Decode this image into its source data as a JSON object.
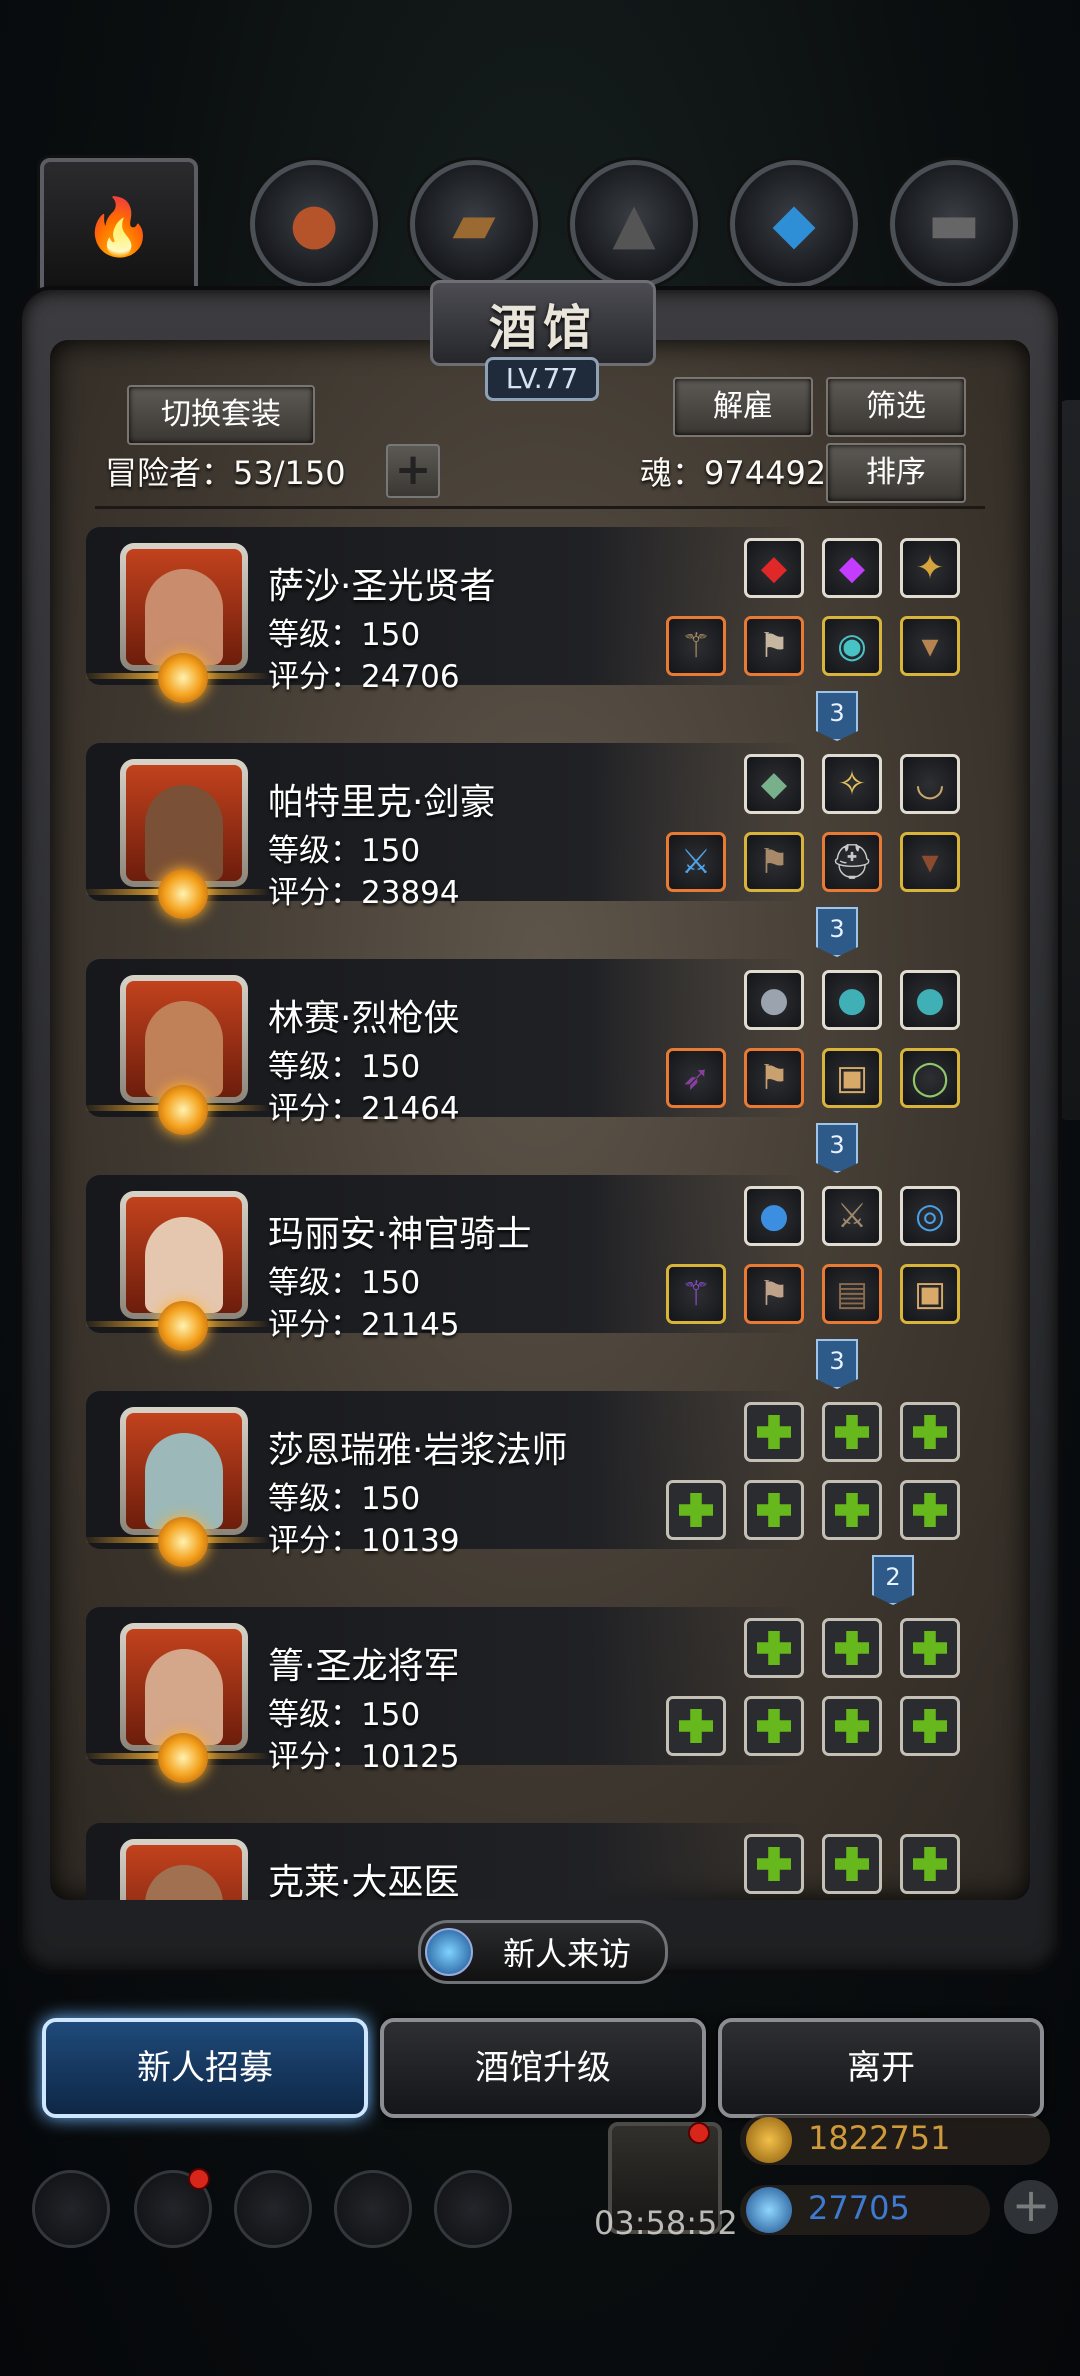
{
  "tabs": [
    {
      "icon": "flame-icon"
    },
    {
      "icon": "meat-icon"
    },
    {
      "icon": "wood-icon"
    },
    {
      "icon": "ore-icon"
    },
    {
      "icon": "crystal-icon"
    },
    {
      "icon": "metal-icon"
    }
  ],
  "header": {
    "title": "酒馆",
    "level": "LV.77",
    "switch_outfit": "切换套装",
    "dismiss": "解雇",
    "filter": "筛选",
    "sort": "排序",
    "adventurers": "冒险者：53/150",
    "soul": "魂：974492"
  },
  "heroes": [
    {
      "name": "萨沙·圣光贤者",
      "level": "等级：150",
      "score": "评分：24706",
      "face": "#c98c6c",
      "top": [
        {
          "icon": "red-gem-icon",
          "glyph": "◆",
          "color": "#e02828",
          "frame": "white"
        },
        {
          "icon": "purple-crystal-icon",
          "glyph": "◆",
          "color": "#c33cff",
          "frame": "white"
        },
        {
          "icon": "gold-ornament-icon",
          "glyph": "✦",
          "color": "#d6a43c",
          "frame": "white"
        }
      ],
      "bottom": [
        {
          "icon": "staff-icon",
          "glyph": "⚚",
          "color": "#b2926a",
          "frame": "orange"
        },
        {
          "icon": "armor-icon",
          "glyph": "⚑",
          "color": "#c8b7a0",
          "frame": "orange"
        },
        {
          "icon": "shield-icon",
          "glyph": "◉",
          "color": "#47c2c5",
          "frame": "gold"
        },
        {
          "icon": "boots-icon",
          "glyph": "▾",
          "color": "#b58450",
          "frame": "gold"
        }
      ],
      "marker": "3"
    },
    {
      "name": "帕特里克·剑豪",
      "level": "等级：150",
      "score": "评分：23894",
      "face": "#7a5036",
      "top": [
        {
          "icon": "green-crystal-icon",
          "glyph": "◆",
          "color": "#79b08c",
          "frame": "white"
        },
        {
          "icon": "lantern-icon",
          "glyph": "✧",
          "color": "#e6c45a",
          "frame": "white"
        },
        {
          "icon": "bowl-icon",
          "glyph": "◡",
          "color": "#caa768",
          "frame": "white"
        }
      ],
      "bottom": [
        {
          "icon": "sword-icon",
          "glyph": "⚔",
          "color": "#4da3e6",
          "frame": "orange"
        },
        {
          "icon": "armor-icon",
          "glyph": "⚑",
          "color": "#a88a6a",
          "frame": "gold"
        },
        {
          "icon": "helmet-icon",
          "glyph": "⛑",
          "color": "#c9c9c9",
          "frame": "orange"
        },
        {
          "icon": "boots-icon",
          "glyph": "▾",
          "color": "#8c4a2e",
          "frame": "gold"
        }
      ],
      "marker": "3"
    },
    {
      "name": "林赛·烈枪侠",
      "level": "等级：150",
      "score": "评分：21464",
      "face": "#c08058",
      "top": [
        {
          "icon": "stone-icon",
          "glyph": "●",
          "color": "#9aa3ae",
          "frame": "white"
        },
        {
          "icon": "teal-stone-icon",
          "glyph": "●",
          "color": "#3fb0b6",
          "frame": "white"
        },
        {
          "icon": "teal-stone-icon",
          "glyph": "●",
          "color": "#3fb0b6",
          "frame": "white"
        }
      ],
      "bottom": [
        {
          "icon": "gun-icon",
          "glyph": "➶",
          "color": "#8a3fa0",
          "frame": "orange"
        },
        {
          "icon": "armor-icon",
          "glyph": "⚑",
          "color": "#c9a070",
          "frame": "orange"
        },
        {
          "icon": "scroll-icon",
          "glyph": "▣",
          "color": "#d8a968",
          "frame": "gold"
        },
        {
          "icon": "ring-icon",
          "glyph": "◯",
          "color": "#8fc76a",
          "frame": "gold"
        }
      ],
      "marker": "3"
    },
    {
      "name": "玛丽安·神官骑士",
      "level": "等级：150",
      "score": "评分：21145",
      "face": "#e5c7b0",
      "top": [
        {
          "icon": "orb-icon",
          "glyph": "●",
          "color": "#3c8fe0",
          "frame": "white"
        },
        {
          "icon": "dagger-icon",
          "glyph": "⚔",
          "color": "#a08a6a",
          "frame": "white"
        },
        {
          "icon": "amulet-icon",
          "glyph": "◎",
          "color": "#4aa0e6",
          "frame": "white"
        }
      ],
      "bottom": [
        {
          "icon": "staff-icon",
          "glyph": "⚚",
          "color": "#8a4fd0",
          "frame": "gold"
        },
        {
          "icon": "armor-icon",
          "glyph": "⚑",
          "color": "#c0a28a",
          "frame": "orange"
        },
        {
          "icon": "book-icon",
          "glyph": "▤",
          "color": "#8a6a4a",
          "frame": "orange"
        },
        {
          "icon": "scroll-icon",
          "glyph": "▣",
          "color": "#d8a968",
          "frame": "gold"
        }
      ],
      "marker": "3"
    },
    {
      "name": "莎恩瑞雅·岩浆法师",
      "level": "等级：150",
      "score": "评分：10139",
      "face": "#9cb8b8",
      "top": [
        {
          "icon": "add-slot-icon",
          "frame": "empty"
        },
        {
          "icon": "add-slot-icon",
          "frame": "empty"
        },
        {
          "icon": "add-slot-icon",
          "frame": "empty"
        }
      ],
      "bottom": [
        {
          "icon": "add-slot-icon",
          "frame": "empty"
        },
        {
          "icon": "add-slot-icon",
          "frame": "empty"
        },
        {
          "icon": "add-slot-icon",
          "frame": "empty"
        },
        {
          "icon": "add-slot-icon",
          "frame": "empty"
        }
      ],
      "marker": "2"
    },
    {
      "name": "箐·圣龙将军",
      "level": "等级：150",
      "score": "评分：10125",
      "face": "#d4a68a",
      "top": [
        {
          "icon": "add-slot-icon",
          "frame": "empty"
        },
        {
          "icon": "add-slot-icon",
          "frame": "empty"
        },
        {
          "icon": "add-slot-icon",
          "frame": "empty"
        }
      ],
      "bottom": [
        {
          "icon": "add-slot-icon",
          "frame": "empty"
        },
        {
          "icon": "add-slot-icon",
          "frame": "empty"
        },
        {
          "icon": "add-slot-icon",
          "frame": "empty"
        },
        {
          "icon": "add-slot-icon",
          "frame": "empty"
        }
      ],
      "marker": ""
    },
    {
      "name": "克莱·大巫医",
      "level": "",
      "score": "",
      "face": "#a07050",
      "top": [
        {
          "icon": "add-slot-icon",
          "frame": "empty"
        },
        {
          "icon": "add-slot-icon",
          "frame": "empty"
        },
        {
          "icon": "add-slot-icon",
          "frame": "empty"
        }
      ],
      "bottom": [],
      "marker": ""
    }
  ],
  "bottom": {
    "new_visitor": "新人来访",
    "recruit": "新人招募",
    "upgrade": "酒馆升级",
    "leave": "离开",
    "timer": "03:58:52",
    "gold": "1822751",
    "gems": "27705"
  }
}
